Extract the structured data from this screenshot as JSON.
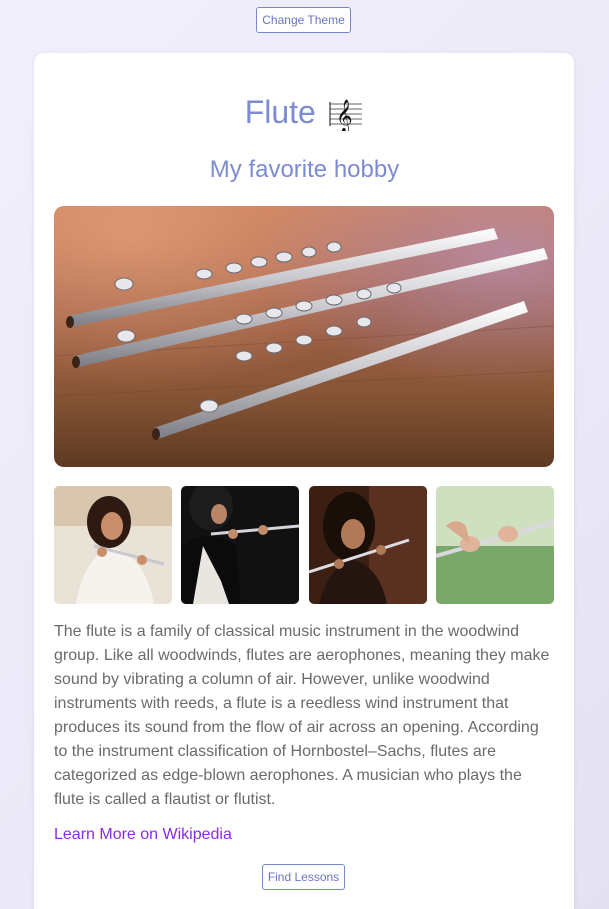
{
  "header": {
    "change_theme_label": "Change Theme"
  },
  "card": {
    "title": "Flute",
    "title_icon": "treble-clef-staff-icon",
    "subtitle": "My favorite hobby",
    "hero_image": "flute-photo",
    "gallery": [
      {
        "image": "flutist-woman-white-dress-photo"
      },
      {
        "image": "flutist-dark-background-photo"
      },
      {
        "image": "young-woman-playing-flute-photo"
      },
      {
        "image": "hands-playing-flute-photo"
      }
    ],
    "description": "The flute is a family of classical music instrument in the woodwind group. Like all woodwinds, flutes are aerophones, meaning they make sound by vibrating a column of air. However, unlike woodwind instruments with reeds, a flute is a reedless wind instrument that produces its sound from the flow of air across an opening. According to the instrument classification of Hornbostel–Sachs, flutes are categorized as edge-blown aerophones. A musician who plays the flute is called a flautist or flutist.",
    "link_label": "Learn More on Wikipedia",
    "find_lessons_label": "Find Lessons"
  },
  "colors": {
    "accent": "#7d8bd1",
    "link": "#8a2be2",
    "text": "#6a6a6a",
    "background": "#ebe8f7"
  }
}
